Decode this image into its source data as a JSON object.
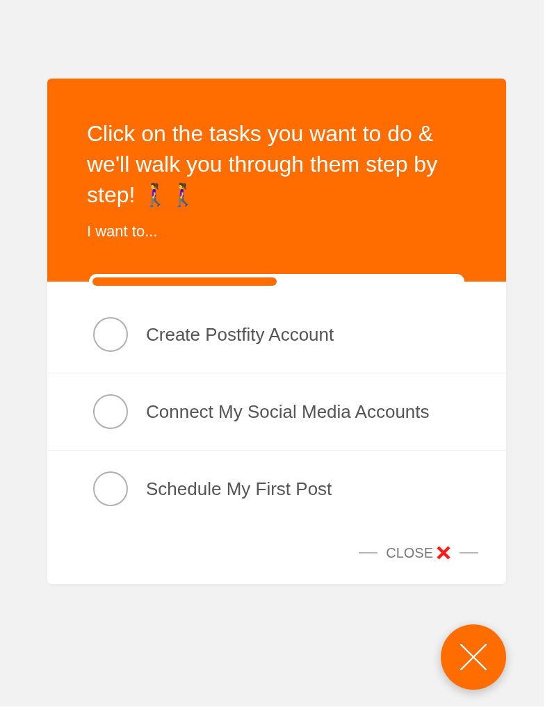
{
  "header": {
    "title": "Click on the tasks you want to do & we'll walk you through them step by step! 🚶‍♀️🚶‍♀️",
    "subtitle": "I want to..."
  },
  "progress": {
    "level": 0.5
  },
  "tasks": [
    {
      "label": "Create Postfity Account",
      "checked": false
    },
    {
      "label": "Connect My Social Media Accounts",
      "checked": false
    },
    {
      "label": "Schedule My First Post",
      "checked": false
    }
  ],
  "close_link": {
    "label": "CLOSE"
  }
}
